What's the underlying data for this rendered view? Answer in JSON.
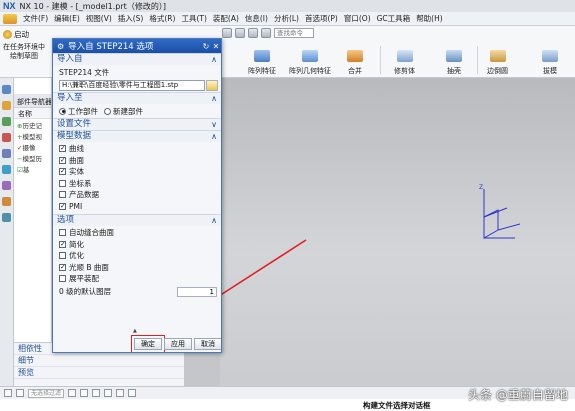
{
  "window": {
    "logo": "NX",
    "title": "NX 10 - 建模 - [_model1.prt（修改的）]"
  },
  "menu": {
    "items": [
      "文件(F)",
      "编辑(E)",
      "视图(V)",
      "插入(S)",
      "格式(R)",
      "工具(T)",
      "装配(A)",
      "信息(I)",
      "分析(L)",
      "首选项(P)",
      "窗口(O)",
      "GC工具箱",
      "帮助(H)"
    ]
  },
  "ribbon": {
    "start_label": "启动",
    "task_label": "在任务环境中绘制草图",
    "search_placeholder": "查找命令",
    "groups": [
      "阵列特征",
      "阵列几何特征",
      "合并",
      "修剪体",
      "抽壳",
      "边倒圆",
      "拔模"
    ]
  },
  "navigator": {
    "title": "部件导航器",
    "column": "名称",
    "rows": [
      "历史记",
      "模型视",
      "摄像",
      "模型历",
      "基"
    ]
  },
  "dialog": {
    "title": "导入自 STEP214 选项",
    "sections": {
      "import_from": "导入自",
      "import_to": "导入至",
      "settings_file": "设置文件",
      "model_data": "模型数据",
      "options": "选项"
    },
    "file_label": "STEP214 文件",
    "file_path": "H:\\兼职\\百度经验\\零件与工程图1.stp",
    "radio_work": "工作部件",
    "radio_new": "新建部件",
    "model_items": [
      {
        "label": "曲线",
        "checked": true
      },
      {
        "label": "曲面",
        "checked": true
      },
      {
        "label": "实体",
        "checked": true
      },
      {
        "label": "坐标系",
        "checked": false
      },
      {
        "label": "产品数据",
        "checked": false
      },
      {
        "label": "PMI",
        "checked": true
      }
    ],
    "option_items": [
      {
        "label": "自动缝合曲面",
        "checked": false
      },
      {
        "label": "简化",
        "checked": true
      },
      {
        "label": "优化",
        "checked": false
      },
      {
        "label": "光顺 B 曲面",
        "checked": true
      },
      {
        "label": "展平装配",
        "checked": false
      }
    ],
    "default_layer_label": "0 级的默认图层",
    "default_layer_value": "1",
    "buttons": {
      "ok": "确定",
      "apply": "应用",
      "cancel": "取消"
    }
  },
  "bottom_panel": {
    "items": [
      "相依性",
      "细节",
      "预览"
    ]
  },
  "statusbar": {
    "filter_placeholder": "无选择过滤"
  },
  "caption": "构建文件选择对话框",
  "watermark": "头条 @重蔚自留地",
  "colors": {
    "dialog_header": "#2f6bc7",
    "section_text": "#1f4f95",
    "highlight": "#e02020",
    "axis": "#3333cc"
  }
}
